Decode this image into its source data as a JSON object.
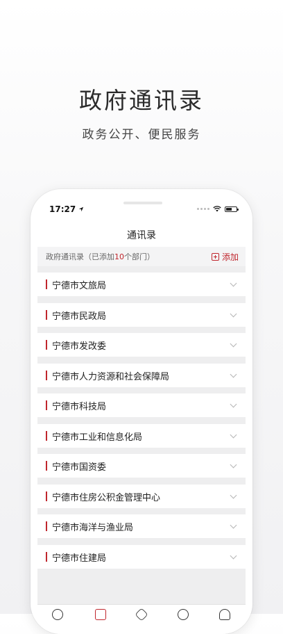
{
  "hero": {
    "title": "政府通讯录",
    "subtitle": "政务公开、便民服务"
  },
  "status_bar": {
    "time": "17:27"
  },
  "nav": {
    "title": "通讯录"
  },
  "summary": {
    "prefix": "政府通讯录（已添加",
    "count": "10",
    "suffix": "个部门）",
    "add_label": "添加"
  },
  "departments": [
    {
      "label": "宁德市文旅局"
    },
    {
      "label": "宁德市民政局"
    },
    {
      "label": "宁德市发改委"
    },
    {
      "label": "宁德市人力资源和社会保障局"
    },
    {
      "label": "宁德市科技局"
    },
    {
      "label": "宁德市工业和信息化局"
    },
    {
      "label": "宁德市国资委"
    },
    {
      "label": "宁德市住房公积金管理中心"
    },
    {
      "label": "宁德市海洋与渔业局"
    },
    {
      "label": "宁德市住建局"
    }
  ],
  "colors": {
    "accent": "#c0262d",
    "list_background": "#eeeeef",
    "summary_background": "#f4f4f5"
  },
  "icons": {
    "status": [
      "location-arrow-icon",
      "signal-dots-icon",
      "wifi-icon",
      "battery-icon"
    ],
    "tabs": [
      "home-tab-icon",
      "contacts-tab-icon",
      "services-tab-icon",
      "discover-tab-icon",
      "profile-tab-icon"
    ],
    "list_item": "chevron-down-icon",
    "add": "plus-square-icon"
  }
}
